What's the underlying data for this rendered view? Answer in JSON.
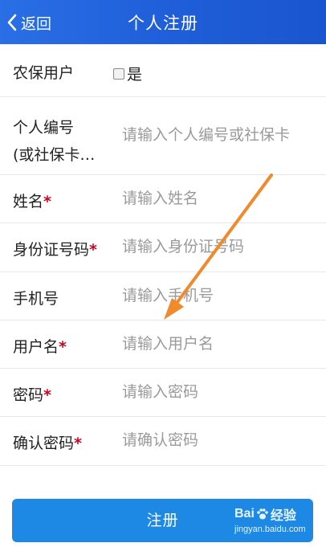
{
  "header": {
    "back_label": "返回",
    "title": "个人注册"
  },
  "form": {
    "farmer_insurance": {
      "label": "农保用户",
      "checkbox_label": "是"
    },
    "personal_id": {
      "label_line1": "个人编号",
      "label_line2": "(或社保卡…",
      "placeholder": "请输入个人编号或社保卡"
    },
    "name": {
      "label": "姓名",
      "required": "*",
      "placeholder": "请输入姓名"
    },
    "id_card": {
      "label": "身份证号码",
      "required": "*",
      "placeholder": "请输入身份证号码"
    },
    "phone": {
      "label": "手机号",
      "placeholder": "请输入手机号"
    },
    "username": {
      "label": "用户名",
      "required": "*",
      "placeholder": "请输入用户名"
    },
    "password": {
      "label": "密码",
      "required": "*",
      "placeholder": "请输入密码"
    },
    "confirm_password": {
      "label": "确认密码",
      "required": "*",
      "placeholder": "请确认密码"
    }
  },
  "register_button": "注册",
  "watermark": {
    "brand_left": "Bai",
    "brand_right": "经验",
    "url": "jingyan.baidu.com"
  },
  "icons": {
    "back": "chevron-left-icon",
    "annotation_arrow": "orange-arrow-icon",
    "watermark_paw": "baidu-paw-icon"
  },
  "colors": {
    "header": "#1f5fd9",
    "button": "#1e88e5",
    "required": "#d0021b",
    "arrow": "#f08a2c",
    "placeholder": "#9a9a9a"
  }
}
